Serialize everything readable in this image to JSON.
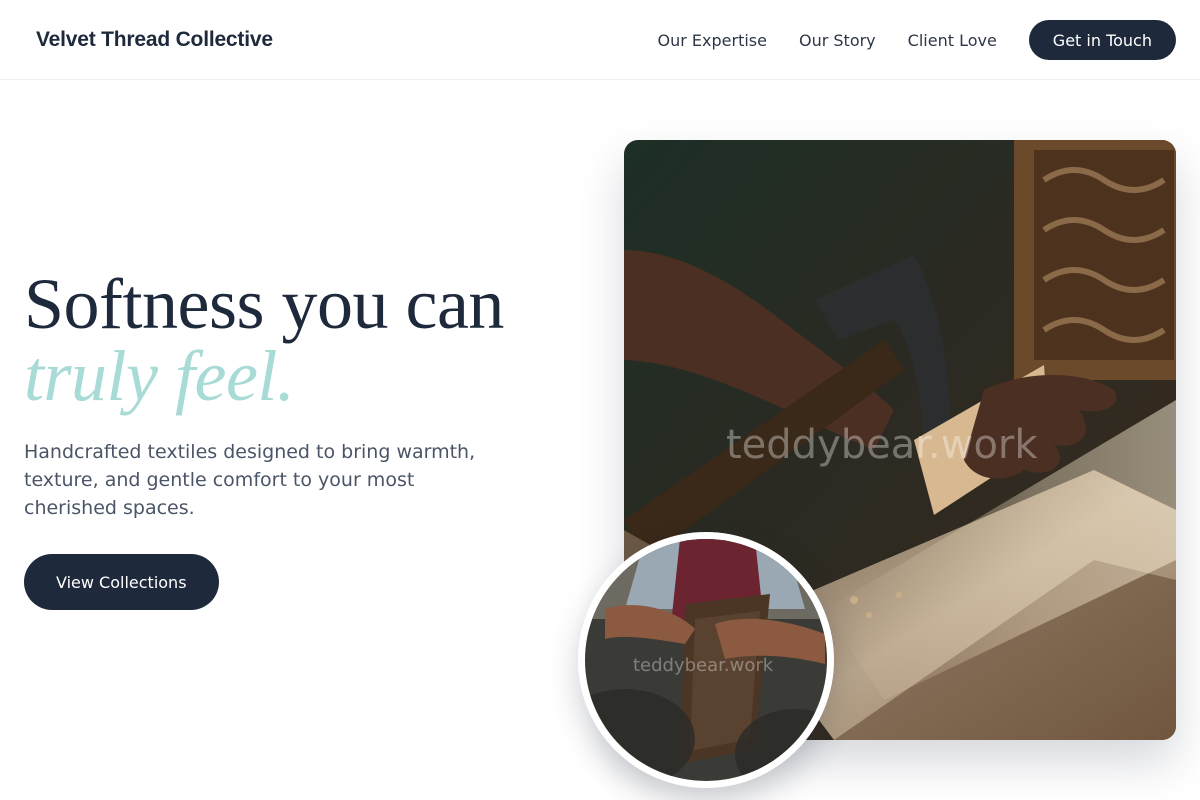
{
  "nav": {
    "brand": "Velvet Thread Collective",
    "links": [
      "Our Expertise",
      "Our Story",
      "Client Love"
    ],
    "cta": "Get in Touch"
  },
  "hero": {
    "headline_line1": "Softness you can",
    "headline_line2": "truly feel.",
    "subtext": "Handcrafted textiles designed to bring warmth, texture, and gentle comfort to your most cherished spaces.",
    "cta": "View Collections"
  },
  "images": {
    "main_watermark": "teddybear.work",
    "inset_watermark": "teddybear.work"
  },
  "colors": {
    "primary": "#1e293b",
    "accent": "#a8dad6",
    "body_text": "#4a5568"
  }
}
